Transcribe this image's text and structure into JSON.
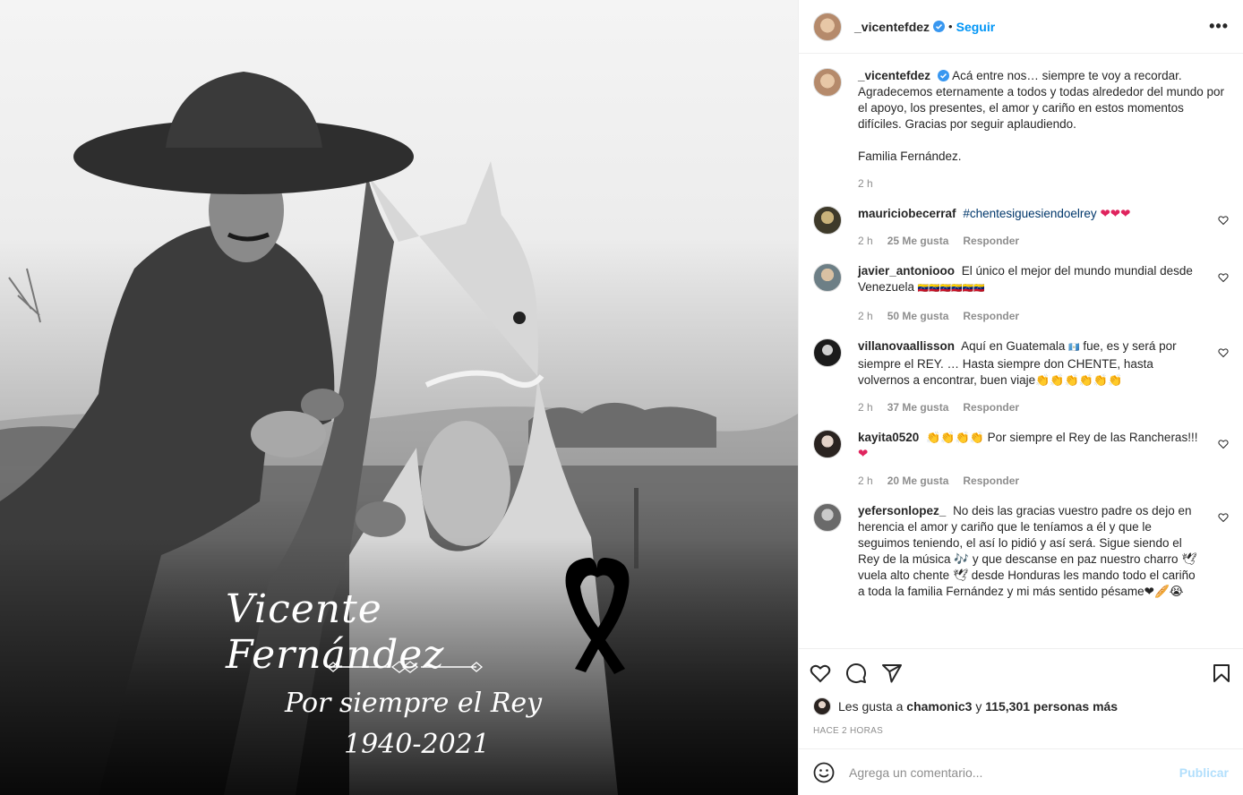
{
  "photo": {
    "title": "Vicente Fernández",
    "subtitle": "Por siempre el Rey",
    "years": "1940-2021"
  },
  "header": {
    "username": "_vicentefdez",
    "separator": "•",
    "follow_label": "Seguir",
    "more_label": "•••"
  },
  "caption": {
    "username": "_vicentefdez",
    "text": "Acá entre nos… siempre te voy a recordar. Agradecemos eternamente a todos y todas alrededor del mundo por el apoyo, los presentes, el amor y cariño en estos momentos difíciles. Gracias por seguir aplaudiendo.",
    "signature": "Familia Fernández.",
    "time": "2 h"
  },
  "comments": [
    {
      "username": "mauriciobecerraf",
      "hashtag": "#chentesiguesiendoelrey",
      "text": "",
      "emoji": "❤❤❤",
      "time": "2 h",
      "likes": "25 Me gusta",
      "reply": "Responder"
    },
    {
      "username": "javier_antoniooo",
      "text": "El único el mejor del mundo mundial desde Venezuela",
      "emoji": "🇻🇪🇻🇪🇻🇪🇻🇪🇻🇪🇻🇪",
      "time": "2 h",
      "likes": "50 Me gusta",
      "reply": "Responder"
    },
    {
      "username": "villanovaallisson",
      "text": "Aquí en Guatemala",
      "flag": "🇬🇹",
      "text2": "fue, es y será por siempre el REY. … Hasta siempre don CHENTE, hasta volvernos a encontrar, buen viaje",
      "emoji": "👏👏👏👏👏👏",
      "time": "2 h",
      "likes": "37 Me gusta",
      "reply": "Responder"
    },
    {
      "username": "kayita0520",
      "emoji_pre": "👏👏👏👏",
      "text": "Por siempre el Rey de las Rancheras!!!",
      "emoji": "❤",
      "time": "2 h",
      "likes": "20 Me gusta",
      "reply": "Responder"
    },
    {
      "username": "yefersonlopez_",
      "text": "No deis las gracias vuestro padre os dejo en herencia el amor y cariño que le teníamos a él y que le seguimos teniendo, el así lo pidió y así será. Sigue siendo el Rey de la música 🎶 y que descanse en paz nuestro charro 🕊 vuela alto chente 🕊 desde Honduras les mando todo el cariño a toda la familia Fernández y mi más sentido pésame",
      "emoji": "❤🥖😭",
      "time": "",
      "likes": "",
      "reply": ""
    }
  ],
  "likes": {
    "prefix": "Les gusta a",
    "user": "chamonic3",
    "middle": "y",
    "count": "115,301 personas más"
  },
  "timestamp": "HACE 2 HORAS",
  "add_comment": {
    "placeholder": "Agrega un comentario...",
    "publish_label": "Publicar"
  }
}
